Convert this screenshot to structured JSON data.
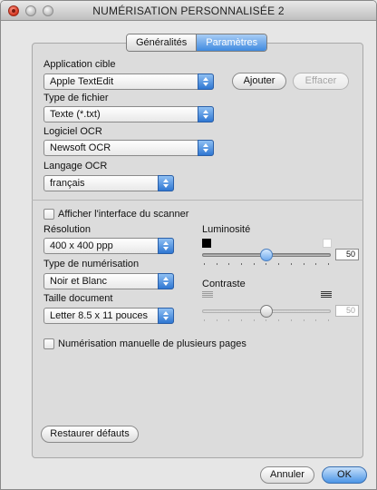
{
  "window": {
    "title": "NUMÉRISATION PERSONNALISÉE 2"
  },
  "tabs": [
    {
      "label": "Généralités",
      "active": false
    },
    {
      "label": "Paramètres",
      "active": true
    }
  ],
  "application": {
    "label": "Application cible",
    "value": "Apple TextEdit",
    "add_label": "Ajouter",
    "delete_label": "Effacer"
  },
  "file_type": {
    "label": "Type de fichier",
    "value": "Texte (*.txt)"
  },
  "ocr_software": {
    "label": "Logiciel OCR",
    "value": "Newsoft OCR"
  },
  "ocr_language": {
    "label": "Langage OCR",
    "value": "français"
  },
  "scanner_ui": {
    "label": "Afficher l'interface du scanner",
    "checked": false
  },
  "resolution": {
    "label": "Résolution",
    "value": "400 x 400 ppp"
  },
  "scan_type": {
    "label": "Type de numérisation",
    "value": "Noir et Blanc"
  },
  "doc_size": {
    "label": "Taille document",
    "value": "Letter  8.5 x 11 pouces"
  },
  "brightness": {
    "label": "Luminosité",
    "value": "50",
    "level": 50,
    "enabled": true
  },
  "contrast": {
    "label": "Contraste",
    "value": "50",
    "level": 50,
    "enabled": false
  },
  "manual_multi": {
    "label": "Numérisation manuelle de plusieurs pages",
    "checked": false
  },
  "footer": {
    "restore_label": "Restaurer défauts",
    "cancel_label": "Annuler",
    "ok_label": "OK"
  },
  "colors": {
    "accent": "#3f8ae0",
    "panel": "#dcdcdc",
    "window": "#e6e6e6"
  }
}
